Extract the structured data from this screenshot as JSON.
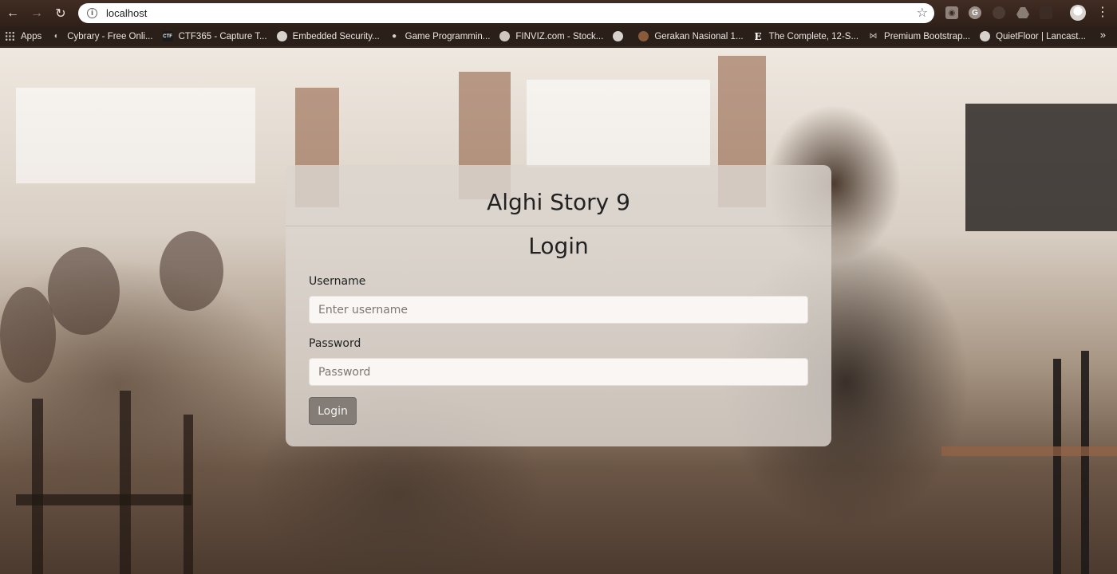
{
  "browser": {
    "url": "localhost",
    "bookmarks": [
      {
        "label": "Apps",
        "icon": "apps-grid-icon"
      },
      {
        "label": "Cybrary - Free Onli...",
        "icon": "cybrary-icon"
      },
      {
        "label": "CTF365 - Capture T...",
        "icon": "ctf-icon"
      },
      {
        "label": "Embedded Security...",
        "icon": "globe-icon"
      },
      {
        "label": "Game Programmin...",
        "icon": "pin-icon"
      },
      {
        "label": "FINVIZ.com - Stock...",
        "icon": "finviz-icon"
      },
      {
        "label": "",
        "icon": "globe-icon"
      },
      {
        "label": "Gerakan Nasional 1...",
        "icon": "site-icon"
      },
      {
        "label": "The Complete, 12-S...",
        "icon": "e-icon"
      },
      {
        "label": "Premium Bootstrap...",
        "icon": "bow-icon"
      },
      {
        "label": "QuietFloor | Lancast...",
        "icon": "globe-icon"
      }
    ],
    "more_label": "»"
  },
  "login": {
    "site_title": "Alghi Story 9",
    "heading": "Login",
    "username_label": "Username",
    "username_placeholder": "Enter username",
    "password_label": "Password",
    "password_placeholder": "Password",
    "button_label": "Login"
  }
}
